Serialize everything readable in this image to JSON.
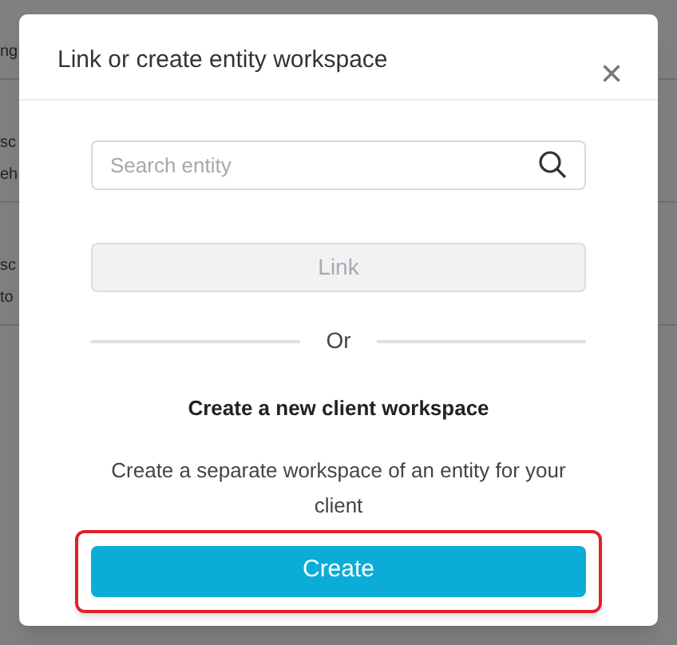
{
  "background_table": {
    "rows": [
      {
        "column_1": [
          "ng"
        ]
      },
      {
        "column_1": [
          "sc",
          "eh"
        ]
      },
      {
        "column_1": [
          "sc",
          "to"
        ]
      }
    ]
  },
  "dialog": {
    "title": "Link or create entity workspace",
    "close": "×",
    "search": {
      "placeholder": "Search entity"
    },
    "link_button": {
      "label": "Link",
      "disabled": true
    },
    "separator": "Or",
    "heading": "Create a new client workspace",
    "description": "Create a separate workspace of an entity for your client",
    "create_button": {
      "label": "Create",
      "highlighted": true
    }
  }
}
